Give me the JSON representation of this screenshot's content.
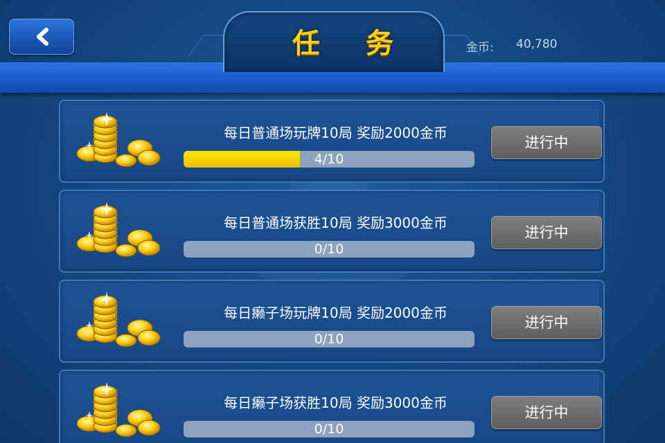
{
  "header": {
    "title": "任 务",
    "coins_label": "金币:",
    "coins_value": "40,780"
  },
  "tasks": [
    {
      "text": "每日普通场玩牌10局 奖励2000金币",
      "progress_label": "4/10",
      "progress": 0.4,
      "status": "进行中"
    },
    {
      "text": "每日普通场获胜10局 奖励3000金币",
      "progress_label": "0/10",
      "progress": 0,
      "status": "进行中"
    },
    {
      "text": "每日癞子场玩牌10局 奖励2000金币",
      "progress_label": "0/10",
      "progress": 0,
      "status": "进行中"
    },
    {
      "text": "每日癞子场获胜10局 奖励3000金币",
      "progress_label": "0/10",
      "progress": 0,
      "status": "进行中"
    }
  ],
  "colors": {
    "progress_fill": "#ffdc00",
    "title": "#ffd21a"
  },
  "icons": {
    "back": "chevron-left-icon",
    "reward": "coin-pile-icon"
  }
}
